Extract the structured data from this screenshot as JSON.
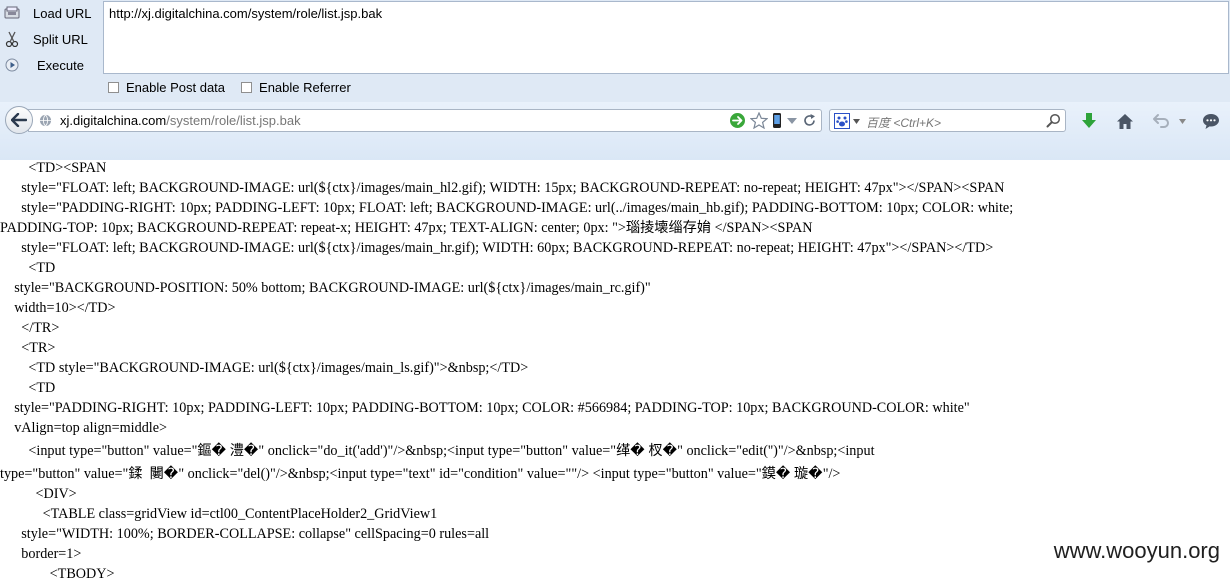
{
  "hackbar": {
    "actions": [
      {
        "label": "Load URL",
        "icon": "load-url-icon"
      },
      {
        "label": "Split URL",
        "icon": "split-url-icon"
      },
      {
        "label": "Execute",
        "icon": "execute-icon"
      }
    ],
    "url_value": "http://xj.digitalchina.com/system/role/list.jsp.bak",
    "options": [
      {
        "label": "Enable Post data",
        "checked": false
      },
      {
        "label": "Enable Referrer",
        "checked": false
      }
    ]
  },
  "navbar": {
    "url_host": "xj.digitalchina.com",
    "url_path": "/system/role/list.jsp.bak",
    "search_placeholder": "百度 <Ctrl+K>"
  },
  "source_lines": [
    "        <TD><SPAN",
    "      style=\"FLOAT: left; BACKGROUND-IMAGE: url(${ctx}/images/main_hl2.gif); WIDTH: 15px; BACKGROUND-REPEAT: no-repeat; HEIGHT: 47px\"></SPAN><SPAN",
    "      style=\"PADDING-RIGHT: 10px; PADDING-LEFT: 10px; FLOAT: left; BACKGROUND-IMAGE: url(../images/main_hb.gif); PADDING-BOTTOM: 10px; COLOR: white;",
    "PADDING-TOP: 10px; BACKGROUND-REPEAT: repeat-x; HEIGHT: 47px; TEXT-ALIGN: center; 0px: \">瑙掕壊缁存姢 </SPAN><SPAN",
    "      style=\"FLOAT: left; BACKGROUND-IMAGE: url(${ctx}/images/main_hr.gif); WIDTH: 60px; BACKGROUND-REPEAT: no-repeat; HEIGHT: 47px\"></SPAN></TD>",
    "        <TD",
    "    style=\"BACKGROUND-POSITION: 50% bottom; BACKGROUND-IMAGE: url(${ctx}/images/main_rc.gif)\"",
    "    width=10></TD>",
    "      </TR>",
    "      <TR>",
    "        <TD style=\"BACKGROUND-IMAGE: url(${ctx}/images/main_ls.gif)\">&nbsp;</TD>",
    "        <TD",
    "    style=\"PADDING-RIGHT: 10px; PADDING-LEFT: 10px; PADDING-BOTTOM: 10px; COLOR: #566984; PADDING-TOP: 10px; BACKGROUND-COLOR: white\"",
    "    vAlign=top align=middle>",
    "        <input type=\"button\" value=\"鏂� 澧�\" onclick=\"do_it('add')\"/>&nbsp;<input type=\"button\" value=\"缂� 杈�\" onclick=\"edit('')\"/>&nbsp;<input",
    "type=\"button\" value=\"鍒  闄�\" onclick=\"del()\"/>&nbsp;<input type=\"text\" id=\"condition\" value=\"\"/> <input type=\"button\" value=\"鏌� 璇�\"/>",
    "          <DIV>",
    "            <TABLE class=gridView id=ctl00_ContentPlaceHolder2_GridView1",
    "      style=\"WIDTH: 100%; BORDER-COLLAPSE: collapse\" cellSpacing=0 rules=all",
    "      border=1>",
    "              <TBODY>"
  ],
  "watermark": "www.wooyun.org"
}
